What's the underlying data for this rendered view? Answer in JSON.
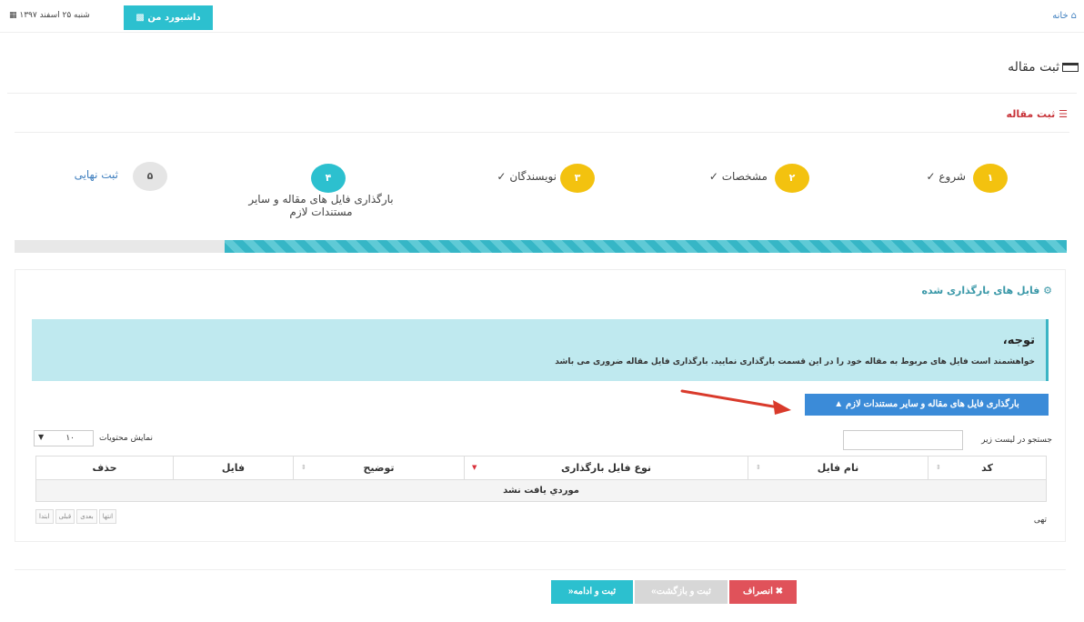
{
  "topbar": {
    "home_label": "خانه",
    "dashboard_label": "داشبورد من",
    "date_text": "شنبه ۲۵ اسفند ۱۳۹۷"
  },
  "page": {
    "title": "ثبت مقاله"
  },
  "panel": {
    "heading": "ثبت مقاله"
  },
  "steps": [
    {
      "number": "۱",
      "label": "شروع",
      "state": "done",
      "color": "#f3c20f"
    },
    {
      "number": "۲",
      "label": "مشخصات",
      "state": "done",
      "color": "#f3c20f"
    },
    {
      "number": "۳",
      "label": "نویسندگان",
      "state": "done",
      "color": "#f3c20f"
    },
    {
      "number": "۴",
      "label": "بارگذاری فایل های مقاله و سایر مستندات لازم",
      "state": "active",
      "color": "#2cc0cf"
    },
    {
      "number": "۵",
      "label": "ثبت نهایی",
      "state": "pending",
      "color": "#e5e5e5"
    }
  ],
  "progress": 0.8,
  "files": {
    "title": "فایل های بارگذاری شده",
    "notice_heading": "توجه،",
    "notice_text": "خواهشمند است فایل های مربوط به مقاله خود را در این قسمت بارگذاری نمایید. بارگذاری فایل مقاله ضروری می باشد",
    "upload_button": "بارگذاری فایل های مقاله و سایر مستندات لازم",
    "search_label": "جستجو در لیست زیر",
    "search_value": "",
    "show_label": "نمایش محتویات",
    "page_size": "۱۰",
    "columns": [
      "کد",
      "نام فایل",
      "نوع فایل بارگذاری",
      "توضیح",
      "فایل",
      "حذف"
    ],
    "empty_message": "موردي يافت نشد",
    "status": "تهی",
    "pager": [
      "ابتدا",
      "قبلی",
      "بعدی",
      "انتها"
    ]
  },
  "actions": {
    "cancel": "انصراف",
    "back": "ثبت و بازگشت»",
    "next": "ثبت و ادامه«"
  }
}
